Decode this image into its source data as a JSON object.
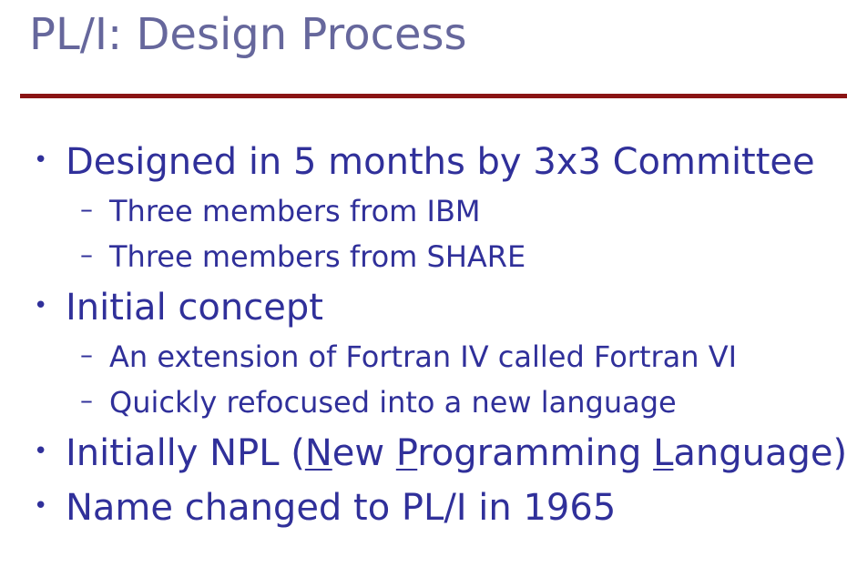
{
  "slide": {
    "title": "PL/I: Design Process",
    "bullet_marker": "•",
    "dash_marker": "–",
    "items": [
      {
        "text": "Designed in 5 months by 3x3 Committee"
      },
      {
        "text": "Three members from IBM"
      },
      {
        "text": "Three members from SHARE"
      },
      {
        "text": "Initial concept"
      },
      {
        "text": "An extension of Fortran IV called Fortran VI"
      },
      {
        "text": "Quickly refocused into a new language"
      },
      {
        "parts": [
          "Initially NPL (",
          "N",
          "ew ",
          "P",
          "rogramming ",
          "L",
          "anguage)"
        ]
      },
      {
        "text": "Name changed to PL/I in 1965"
      }
    ]
  },
  "colors": {
    "title": "#66679c",
    "body": "#30309a",
    "rule": "#8a1414"
  }
}
